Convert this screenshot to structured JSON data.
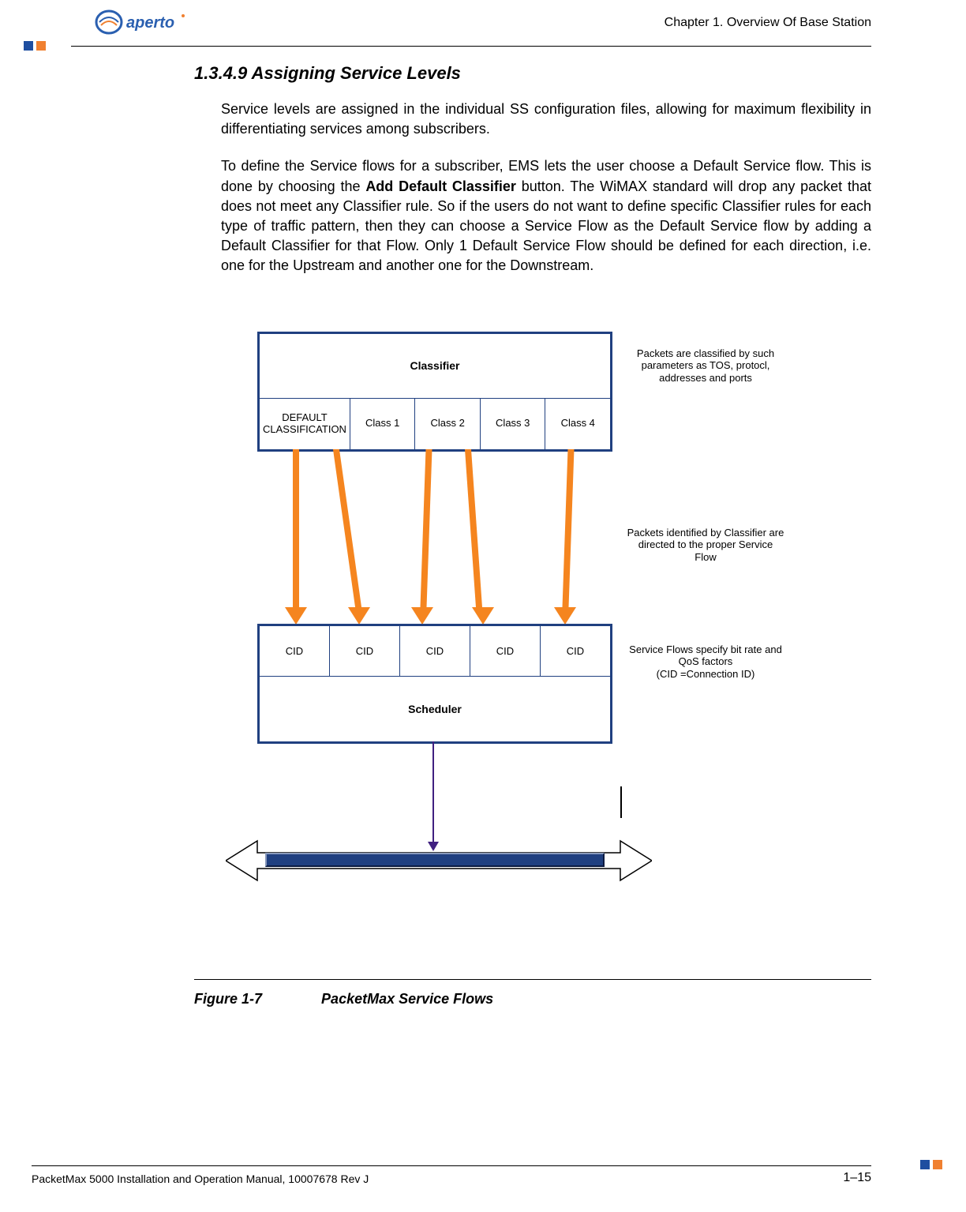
{
  "header": {
    "logo_text": "aperto",
    "chapter": "Chapter 1.  Overview Of Base Station"
  },
  "section": {
    "heading": "1.3.4.9 Assigning Service Levels",
    "para1": "Service levels are assigned in the individual SS configuration files, allowing for maximum flexibility in differentiating services among subscribers.",
    "para2_prefix": "To define the Service flows for a subscriber, EMS lets the user choose a Default Service flow. This is done by choosing the ",
    "para2_bold": "Add Default Classifier",
    "para2_suffix": " button. The WiMAX standard will drop any packet that does not meet any Classifier rule. So if the users do not want to define specific Classifier rules for each type of traffic pattern, then they can choose a Service Flow as the Default Service flow by adding a Default Classifier for that Flow. Only 1 Default Service Flow should be defined for each direction, i.e. one for the Upstream and another one for the Downstream."
  },
  "diagram": {
    "classifier_label": "Classifier",
    "classifier_cells": [
      "DEFAULT CLASSIFICATION",
      "Class 1",
      "Class 2",
      "Class 3",
      "Class 4"
    ],
    "scheduler_label": "Scheduler",
    "cid_labels": [
      "CID",
      "CID",
      "CID",
      "CID",
      "CID"
    ],
    "note1": "Packets are classified by such parameters as TOS, protocl, addresses and ports",
    "note2": "Packets identified by Classifier are directed to the proper Service Flow",
    "note3": "Service Flows specify bit rate and QoS factors\n(CID =Connection ID)"
  },
  "figure": {
    "number": "Figure 1-7",
    "title": "PacketMax Service Flows"
  },
  "footer": {
    "left": "PacketMax 5000 Installation and Operation Manual,   10007678 Rev J",
    "right": "1–15"
  }
}
